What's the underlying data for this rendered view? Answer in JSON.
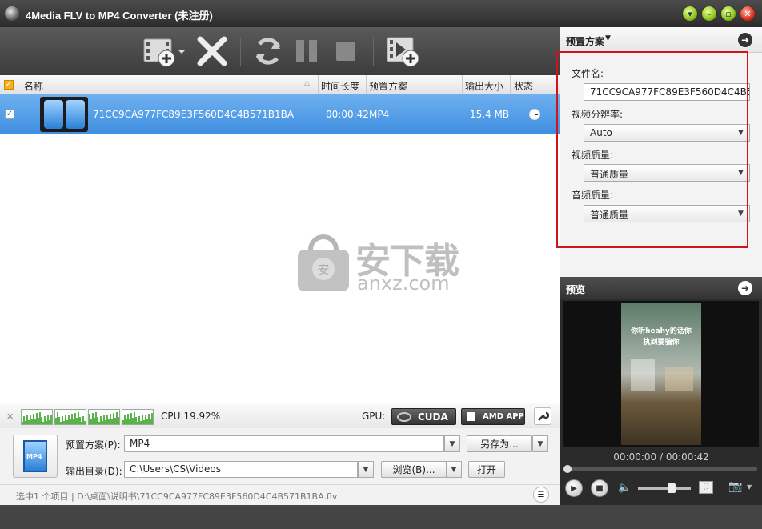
{
  "window": {
    "title": "4Media FLV to MP4 Converter (未注册)"
  },
  "list": {
    "columns": {
      "name": "名称",
      "duration": "时间长度",
      "preset": "预置方案",
      "size": "输出大小",
      "status": "状态"
    },
    "rows": [
      {
        "name": "71CC9CA977FC89E3F560D4C4B571B1BA",
        "duration": "00:00:42",
        "preset": "MP4",
        "size": "15.4 MB"
      }
    ]
  },
  "watermark": {
    "cn": "安下载",
    "en": "anxz.com"
  },
  "cpu": {
    "label": "CPU:19.92%",
    "gpu_label": "GPU:",
    "cuda": "CUDA",
    "amd": "AMD APP"
  },
  "bottom": {
    "preset_label": "预置方案(P):",
    "preset_value": "MP4",
    "save_as": "另存为...",
    "output_label": "输出目录(D):",
    "output_value": "C:\\Users\\CS\\Videos",
    "browse": "浏览(B)...",
    "open": "打开",
    "status": "选中1 个项目 | D:\\桌面\\说明书\\71CC9CA977FC89E3F560D4C4B571B1BA.flv",
    "badge": "MP4"
  },
  "settings": {
    "header": "预置方案",
    "filename_label": "文件名:",
    "filename_value": "71CC9CA977FC89E3F560D4C4B57",
    "resolution_label": "视频分辨率:",
    "resolution_value": "Auto",
    "vquality_label": "视频质量:",
    "vquality_value": "普通质量",
    "aquality_label": "音频质量:",
    "aquality_value": "普通质量"
  },
  "preview": {
    "header": "预览",
    "time": "00:00:00 / 00:00:42",
    "volume": 0.66,
    "video_caption_1": "你听heahy的话你",
    "video_caption_2": "执到要骗你"
  }
}
